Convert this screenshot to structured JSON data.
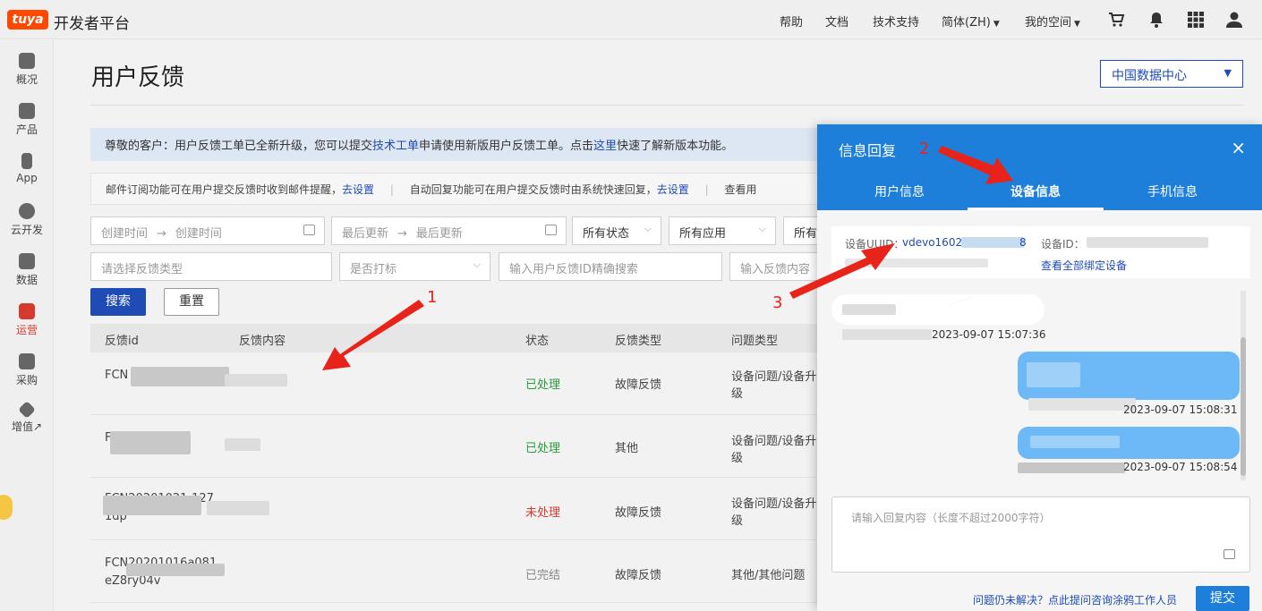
{
  "header": {
    "logo": "tuya",
    "title": "开发者平台",
    "nav": [
      "帮助",
      "文档",
      "技术支持",
      "简体(ZH)",
      "我的空间"
    ],
    "icons": [
      "cart-icon",
      "bell-icon",
      "apps-grid-icon",
      "user-icon"
    ]
  },
  "sidebar": {
    "items": [
      {
        "label": "概况",
        "icon": "home-icon"
      },
      {
        "label": "产品",
        "icon": "terminal-icon"
      },
      {
        "label": "App",
        "icon": "phone-icon"
      },
      {
        "label": "云开发",
        "icon": "cloud-icon"
      },
      {
        "label": "数据",
        "icon": "chart-icon"
      },
      {
        "label": "运营",
        "icon": "bookmark-icon",
        "active": true
      },
      {
        "label": "采购",
        "icon": "box-icon"
      },
      {
        "label": "增值↗",
        "icon": "diamond-icon"
      }
    ],
    "expand": "▸"
  },
  "page": {
    "title": "用户反馈",
    "region": "中国数据中心"
  },
  "notice": {
    "part1": "尊敬的客户：用户反馈工单已全新升级，您可以提交",
    "link1": "技术工单",
    "part2": "申请使用新版用户反馈工单。点击",
    "link2": "这里",
    "part3": "快速了解新版本功能。"
  },
  "tips": {
    "t1": "邮件订阅功能可在用户提交反馈时收到邮件提醒，",
    "l1": "去设置",
    "t2": "自动回复功能可在用户提交反馈时由系统快速回复，",
    "l2": "去设置",
    "t3": "查看用"
  },
  "filters": {
    "created_start": "创建时间",
    "created_end": "创建时间",
    "updated_start": "最后更新",
    "updated_end": "最后更新",
    "status": "所有状态",
    "app": "所有应用",
    "more": "所有",
    "type": "请选择反馈类型",
    "marked": "是否打标",
    "id_search": "输入用户反馈ID精确搜索",
    "content_search": "输入反馈内容",
    "arrow": "→"
  },
  "actions": {
    "search": "搜索",
    "reset": "重置"
  },
  "table": {
    "headers": [
      "反馈id",
      "反馈内容",
      "状态",
      "反馈类型",
      "问题类型"
    ],
    "rows": [
      {
        "id": "FCN",
        "id2": "",
        "status": "已处理",
        "status_kind": "done",
        "type": "故障反馈",
        "issue": "设备问题/设备升",
        "issue2": "级"
      },
      {
        "id": "F",
        "id2": "",
        "status": "已处理",
        "status_kind": "done",
        "type": "其他",
        "issue": "设备问题/设备升",
        "issue2": "级"
      },
      {
        "id": "FCN20201021-127",
        "id2": "1dp",
        "status": "未处理",
        "status_kind": "todo",
        "type": "故障反馈",
        "issue": "设备问题/设备升",
        "issue2": "级"
      },
      {
        "id": "FCN20201016a081",
        "id2": "eZ8ry04v",
        "status": "已完结",
        "status_kind": "over",
        "type": "故障反馈",
        "issue": "其他/其他问题",
        "issue2": ""
      }
    ]
  },
  "panel": {
    "title": "信息回复",
    "close": "×",
    "tabs": [
      "用户信息",
      "设备信息",
      "手机信息"
    ],
    "active_tab": 1,
    "device": {
      "uuid_label": "设备UUID：",
      "uuid_value": "vdevo1602",
      "uuid_tail": "8",
      "id_label": "设备ID：",
      "view_all": "查看全部绑定设备"
    },
    "messages": [
      {
        "side": "left",
        "time": "2023-09-07 15:07:36"
      },
      {
        "side": "right",
        "time": "2023-09-07 15:08:31"
      },
      {
        "side": "right",
        "time": "2023-09-07 15:08:54"
      }
    ],
    "reply_placeholder": "请输入回复内容（长度不超过2000字符）",
    "help_link": "问题仍未解决？点此提问咨询涂鸦工作人员",
    "submit": "提交"
  },
  "annotations": [
    "1",
    "2",
    "3"
  ]
}
